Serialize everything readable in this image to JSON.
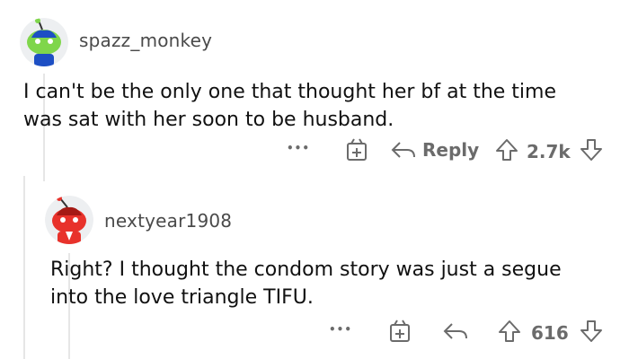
{
  "comments": [
    {
      "username": "spazz_monkey",
      "text_lines": [
        "I can't be the only one that thought her bf at the time",
        "was sat with her soon to be husband."
      ],
      "actions": {
        "more": "•••",
        "reply_label": "Reply",
        "votes": "2.7k"
      },
      "avatar_icon": "snoo-green-avatar"
    },
    {
      "username": "nextyear1908",
      "text_lines": [
        "Right? I thought the condom story was just a segue",
        "into the love triangle TIFU."
      ],
      "actions": {
        "more": "•••",
        "votes": "616"
      },
      "avatar_icon": "snoo-red-avatar"
    }
  ],
  "colors": {
    "meta": "#6b6b6b",
    "thread_line": "#e6e6e6",
    "text": "#111111"
  }
}
